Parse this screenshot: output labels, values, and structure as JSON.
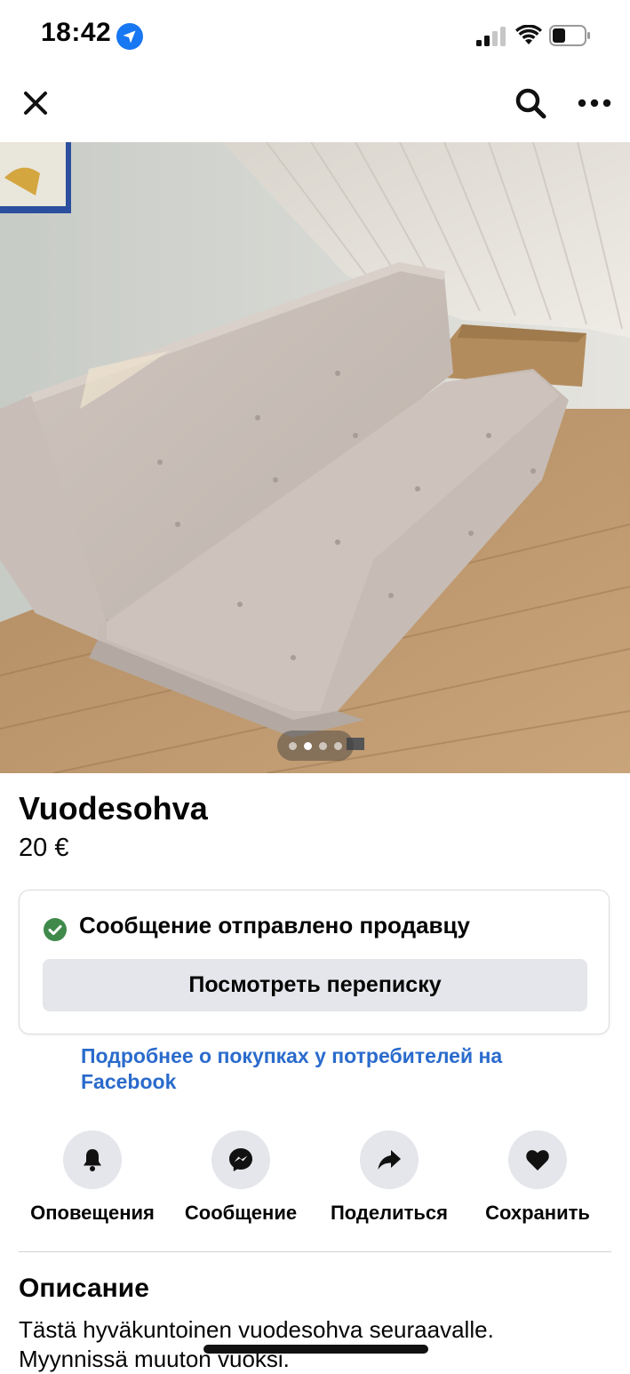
{
  "status_bar": {
    "time": "18:42"
  },
  "nav": {
    "close_icon": "close-icon",
    "search_icon": "search-icon",
    "more_icon": "more-icon"
  },
  "photo": {
    "page_count": 4,
    "active_page": 2
  },
  "listing": {
    "title": "Vuodesohva",
    "price": "20 €"
  },
  "message_card": {
    "status_text": "Сообщение отправлено продавцу",
    "button_label": "Посмотреть переписку"
  },
  "learn_more": {
    "text": "Подробнее о покупках у потребителей на Facebook"
  },
  "actions": [
    {
      "label": "Оповещения",
      "icon": "bell-icon"
    },
    {
      "label": "Сообщение",
      "icon": "messenger-icon"
    },
    {
      "label": "Поделиться",
      "icon": "share-icon"
    },
    {
      "label": "Сохранить",
      "icon": "heart-icon"
    }
  ],
  "description": {
    "heading": "Описание",
    "text": "Tästä hyväkuntoinen vuodesohva seuraavalle. Myynnissä muuton vuoksi."
  },
  "colors": {
    "link": "#2a6bcc",
    "success": "#3f8a4a",
    "button_bg": "#e4e6eb"
  }
}
